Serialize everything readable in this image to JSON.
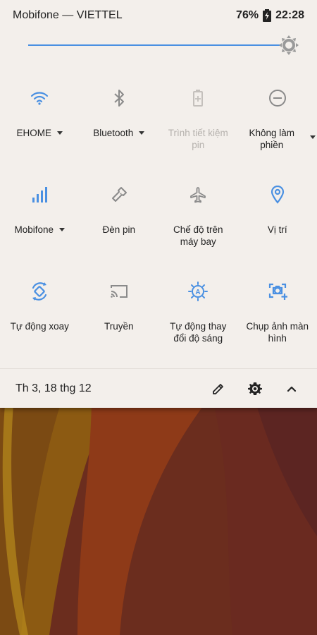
{
  "status_bar": {
    "carrier": "Mobifone — VIETTEL",
    "battery": "76%",
    "time": "22:28"
  },
  "brightness": {
    "level": 0.95
  },
  "tiles": [
    {
      "label": "EHOME",
      "icon": "wifi-icon",
      "active": true,
      "caret": true
    },
    {
      "label": "Bluetooth",
      "icon": "bluetooth-icon",
      "active": false,
      "caret": true
    },
    {
      "label": "Trình tiết kiệm pin",
      "icon": "battery-saver-icon",
      "active": false,
      "caret": false,
      "disabled": true
    },
    {
      "label": "Không làm phiền",
      "icon": "do-not-disturb-icon",
      "active": false,
      "caret": true
    },
    {
      "label": "Mobifone",
      "icon": "cellular-icon",
      "active": true,
      "caret": true
    },
    {
      "label": "Đèn pin",
      "icon": "flashlight-icon",
      "active": false,
      "caret": false
    },
    {
      "label": "Chế độ trên máy bay",
      "icon": "airplane-icon",
      "active": false,
      "caret": false
    },
    {
      "label": "Vị trí",
      "icon": "location-icon",
      "active": true,
      "caret": false
    },
    {
      "label": "Tự động xoay",
      "icon": "auto-rotate-icon",
      "active": true,
      "caret": false
    },
    {
      "label": "Truyền",
      "icon": "cast-icon",
      "active": false,
      "caret": false
    },
    {
      "label": "Tự động thay đổi độ sáng",
      "icon": "auto-brightness-icon",
      "active": true,
      "caret": false
    },
    {
      "label": "Chụp ảnh màn hình",
      "icon": "screenshot-icon",
      "active": true,
      "caret": false
    }
  ],
  "footer": {
    "date": "Th 3, 18 thg 12"
  },
  "colors": {
    "accent": "#4a90e2",
    "inactive": "#8a8a8a",
    "shade": "#f3efeb"
  }
}
